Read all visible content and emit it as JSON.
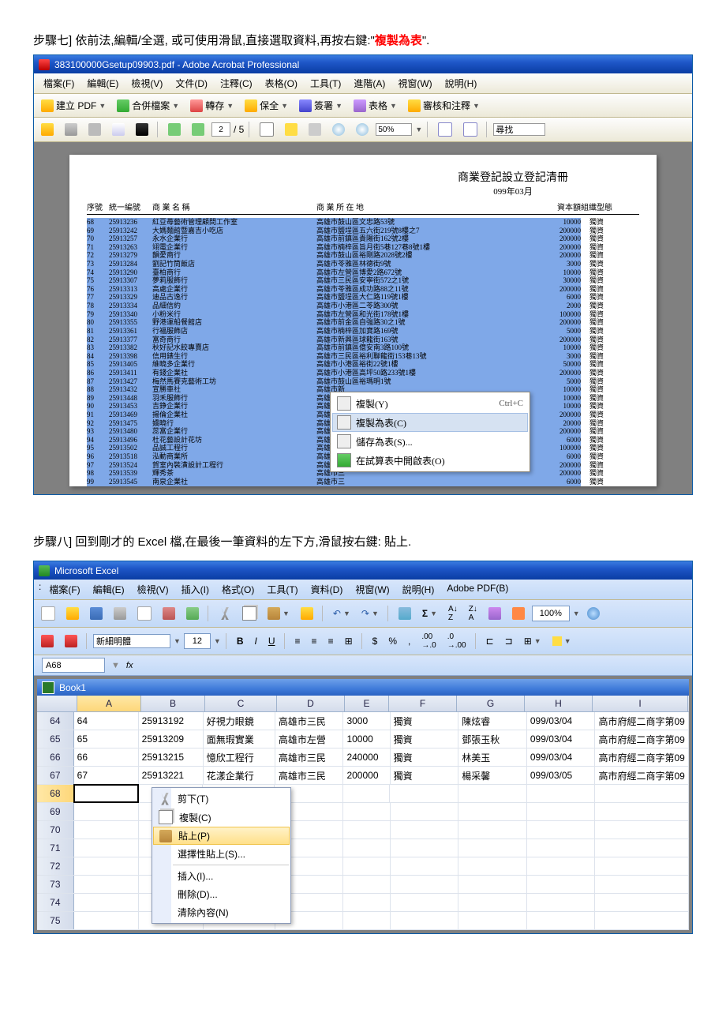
{
  "step7": {
    "prefix": "步驟七] 依前法,編輯/全選, 或可使用滑鼠,直接選取資料,再按右鍵:\"",
    "hl": "複製為表",
    "suffix": "\"."
  },
  "step8": {
    "text": "步驟八] 回到剛才的 Excel 檔,在最後一筆資料的左下方,滑鼠按右鍵: 貼上."
  },
  "acrobat": {
    "title": "383100000Gsetup09903.pdf - Adobe Acrobat Professional",
    "menu": [
      "檔案(F)",
      "編輯(E)",
      "檢視(V)",
      "文件(D)",
      "注釋(C)",
      "表格(O)",
      "工具(T)",
      "進階(A)",
      "視窗(W)",
      "說明(H)"
    ],
    "tb1": [
      "建立 PDF",
      "合併檔案",
      "轉存",
      "保全",
      "簽署",
      "表格",
      "審核和注釋"
    ],
    "page": "2",
    "page_total": "/ 5",
    "zoom": "50%",
    "find": "尋找",
    "ctx": {
      "copy": "複製(Y)",
      "copy_sc": "Ctrl+C",
      "copytable": "複製為表(C)",
      "savetable": "儲存為表(S)...",
      "opensheet": "在試算表中開啟表(O)"
    }
  },
  "pdf": {
    "title": "商業登記設立登記清冊",
    "date": "099年03月",
    "headers": [
      "序號",
      "統一編號",
      "商 業 名 稱",
      "商 業 所 在 地",
      "資本額",
      "組織型態"
    ],
    "rows": [
      [
        "68",
        "25913236",
        "紅豆苺藝術管理顧問工作室",
        "高雄市鼓山區文忠路53號",
        "10000",
        "獨資"
      ],
      [
        "69",
        "25913242",
        "大媽麵館暨嘉吉小吃店",
        "高雄市鹽埕區五六街219號8樓之7",
        "200000",
        "獨資"
      ],
      [
        "70",
        "25913257",
        "永水企業行",
        "高雄市前鎮區貴陽街162號2樓",
        "200000",
        "獨資"
      ],
      [
        "71",
        "25913263",
        "翊電企業行",
        "高雄市楠梓區旨月街5巷127巷8號1樓",
        "200000",
        "獨資"
      ],
      [
        "72",
        "25913279",
        "韻愛商行",
        "高雄市鼓山區裕剛路2028號2樓",
        "200000",
        "獨資"
      ],
      [
        "73",
        "25913284",
        "劉記竹筒飯店",
        "高雄市苓雅區林德街9號",
        "3000",
        "獨資"
      ],
      [
        "74",
        "25913290",
        "臺柏商行",
        "高雄市左營區博愛2路672號",
        "10000",
        "獨資"
      ],
      [
        "75",
        "25913307",
        "夢莉服飾行",
        "高雄市三民區安寧街572之1號",
        "30000",
        "獨資"
      ],
      [
        "76",
        "25913313",
        "高處企業行",
        "高雄市苓雅區成功路88之11號",
        "200000",
        "獨資"
      ],
      [
        "77",
        "25913329",
        "迪品古逸行",
        "高雄市鹽埕區大仁路119號1樓",
        "6000",
        "獨資"
      ],
      [
        "78",
        "25913334",
        "品細信約",
        "高雄市小港區二苓路300號",
        "2000",
        "獨資"
      ],
      [
        "79",
        "25913340",
        "小粉米行",
        "高雄市左營區和光街178號1樓",
        "100000",
        "獨資"
      ],
      [
        "80",
        "25913355",
        "野港運船餐館店",
        "高雄市前金區自強路30之1號",
        "200000",
        "獨資"
      ],
      [
        "81",
        "25913361",
        "行福服飾店",
        "高雄市楠梓區加寶路169號",
        "5000",
        "獨資"
      ],
      [
        "82",
        "25913377",
        "富奇商行",
        "高雄市新興區球龍街163號",
        "200000",
        "獨資"
      ],
      [
        "83",
        "25913382",
        "秋好記水餃專賣店",
        "高雄市前鎮區億安南3路100號",
        "10000",
        "獨資"
      ],
      [
        "84",
        "25913398",
        "信用錶生行",
        "高雄市三民區裕利聯龍街153巷13號",
        "3000",
        "獨資"
      ],
      [
        "85",
        "25913405",
        "維曉多企業行",
        "高雄市小港區裕街22號1樓",
        "50000",
        "獨資"
      ],
      [
        "86",
        "25913411",
        "有錢企業社",
        "高雄市小港區高坪50路233號1樓",
        "200000",
        "獨資"
      ],
      [
        "87",
        "25913427",
        "梅然馬賽克藝術工坊",
        "高雄市鼓山區裕瑪明1號",
        "5000",
        "獨資"
      ],
      [
        "88",
        "25913432",
        "宣勝車社",
        "高雄市新",
        "10000",
        "獨資"
      ],
      [
        "89",
        "25913448",
        "羽禾服飾行",
        "高雄市三",
        "10000",
        "獨資"
      ],
      [
        "90",
        "25913453",
        "吉錚企業行",
        "高雄市三",
        "10000",
        "獨資"
      ],
      [
        "91",
        "25913469",
        "揚倫企業社",
        "高雄市三",
        "200000",
        "獨資"
      ],
      [
        "92",
        "25913475",
        "嬌曉行",
        "高雄市小",
        "20000",
        "獨資"
      ],
      [
        "93",
        "25913480",
        "蕊富企業行",
        "高雄市三",
        "200000",
        "獨資"
      ],
      [
        "94",
        "25913496",
        "杜花藝設計花坊",
        "高雄市三",
        "6000",
        "獨資"
      ],
      [
        "95",
        "25913502",
        "品誠工程行",
        "高雄市鹽",
        "100000",
        "獨資"
      ],
      [
        "96",
        "25913518",
        "泓動商業所",
        "高雄市三",
        "6000",
        "獨資"
      ],
      [
        "97",
        "25913524",
        "賀室內裝潢設計工程行",
        "高雄市三",
        "200000",
        "獨資"
      ],
      [
        "98",
        "25913539",
        "輝秀茶",
        "高雄市三",
        "200000",
        "獨資"
      ],
      [
        "99",
        "25913545",
        "南泉企業社",
        "高雄市三",
        "6000",
        "獨資"
      ]
    ]
  },
  "excel": {
    "title": "Microsoft Excel",
    "menu": [
      "檔案(F)",
      "編輯(E)",
      "檢視(V)",
      "插入(I)",
      "格式(O)",
      "工具(T)",
      "資料(D)",
      "視窗(W)",
      "說明(H)",
      "Adobe PDF(B)"
    ],
    "font": "新細明體",
    "fontsize": "12",
    "zoom": "100%",
    "cellname": "A68",
    "book": "Book1",
    "cols": [
      "",
      "A",
      "B",
      "C",
      "D",
      "E",
      "F",
      "G",
      "H",
      "I"
    ],
    "rows": [
      {
        "n": "64",
        "c": [
          "64",
          "25913192",
          "好視力眼鏡",
          "高雄市三民",
          "3000",
          "獨資",
          "陳炫睿",
          "099/03/04",
          "高市府經二商字第09"
        ]
      },
      {
        "n": "65",
        "c": [
          "65",
          "25913209",
          "面無瑕實業",
          "高雄市左營",
          "10000",
          "獨資",
          "鄧張玉秋",
          "099/03/04",
          "高市府經二商字第09"
        ]
      },
      {
        "n": "66",
        "c": [
          "66",
          "25913215",
          "憶欣工程行",
          "高雄市三民",
          "240000",
          "獨資",
          "林美玉",
          "099/03/04",
          "高市府經二商字第09"
        ]
      },
      {
        "n": "67",
        "c": [
          "67",
          "25913221",
          "花漾企業行",
          "高雄市三民",
          "200000",
          "獨資",
          "楊采馨",
          "099/03/05",
          "高市府經二商字第09"
        ]
      }
    ],
    "empty": [
      "68",
      "69",
      "70",
      "71",
      "72",
      "73",
      "74",
      "75"
    ],
    "ctx": {
      "cut": "剪下(T)",
      "copy": "複製(C)",
      "paste": "貼上(P)",
      "pastespecial": "選擇性貼上(S)...",
      "insert": "插入(I)...",
      "delete": "刪除(D)...",
      "clear": "清除內容(N)"
    }
  }
}
